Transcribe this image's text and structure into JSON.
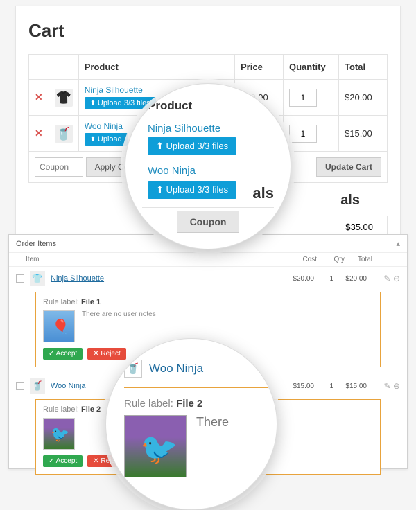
{
  "cart": {
    "title": "Cart",
    "headers": {
      "product": "Product",
      "price": "Price",
      "qty": "Quantity",
      "total": "Total"
    },
    "rows": [
      {
        "name": "Ninja Silhouette",
        "upload": "Upload 3/3 files",
        "price": "$20.00",
        "qty": "1",
        "total": "$20.00"
      },
      {
        "name": "Woo Ninja",
        "upload": "Upload",
        "price": "",
        "qty": "1",
        "total": "$15.00"
      }
    ],
    "coupon_placeholder": "Coupon",
    "apply_coupon": "Apply Coupon",
    "update_cart": "Update Cart",
    "totals_suffix": "als",
    "subtotal": "$35.00"
  },
  "lens1": {
    "header": "Product",
    "items": [
      {
        "name": "Ninja Silhouette",
        "upload": "Upload 3/3 files"
      },
      {
        "name": "Woo Ninja",
        "upload": "Upload 3/3 files"
      }
    ],
    "coupon": "Coupon"
  },
  "order": {
    "panel_title": "Order Items",
    "headers": {
      "item": "Item",
      "cost": "Cost",
      "qty": "Qty",
      "total": "Total"
    },
    "lines": [
      {
        "name": "Ninja Silhouette",
        "cost": "$20.00",
        "qty": "1",
        "total": "$20.00",
        "rule": {
          "label_prefix": "Rule label: ",
          "label": "File 1",
          "note": "There are no user notes",
          "accept": "Accept",
          "reject": "Reject"
        }
      },
      {
        "name": "Woo Ninja",
        "cost": "$15.00",
        "qty": "1",
        "total": "$15.00",
        "rule": {
          "label_prefix": "Rule label: ",
          "label": "File 2",
          "note": "",
          "accept": "Accept",
          "reject": "Reject"
        }
      }
    ]
  },
  "lens2": {
    "name": "Woo Ninja",
    "label_prefix": "Rule label: ",
    "label": "File 2",
    "note_fragment": "There"
  }
}
